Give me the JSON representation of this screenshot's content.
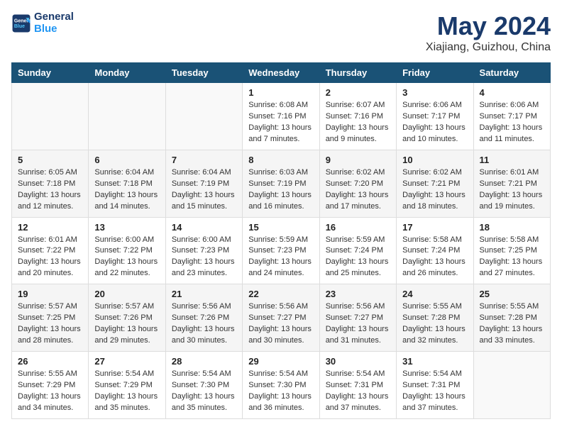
{
  "logo": {
    "line1": "General",
    "line2": "Blue"
  },
  "title": "May 2024",
  "location": "Xiajiang, Guizhou, China",
  "weekdays": [
    "Sunday",
    "Monday",
    "Tuesday",
    "Wednesday",
    "Thursday",
    "Friday",
    "Saturday"
  ],
  "weeks": [
    [
      {
        "day": "",
        "info": ""
      },
      {
        "day": "",
        "info": ""
      },
      {
        "day": "",
        "info": ""
      },
      {
        "day": "1",
        "info": "Sunrise: 6:08 AM\nSunset: 7:16 PM\nDaylight: 13 hours\nand 7 minutes."
      },
      {
        "day": "2",
        "info": "Sunrise: 6:07 AM\nSunset: 7:16 PM\nDaylight: 13 hours\nand 9 minutes."
      },
      {
        "day": "3",
        "info": "Sunrise: 6:06 AM\nSunset: 7:17 PM\nDaylight: 13 hours\nand 10 minutes."
      },
      {
        "day": "4",
        "info": "Sunrise: 6:06 AM\nSunset: 7:17 PM\nDaylight: 13 hours\nand 11 minutes."
      }
    ],
    [
      {
        "day": "5",
        "info": "Sunrise: 6:05 AM\nSunset: 7:18 PM\nDaylight: 13 hours\nand 12 minutes."
      },
      {
        "day": "6",
        "info": "Sunrise: 6:04 AM\nSunset: 7:18 PM\nDaylight: 13 hours\nand 14 minutes."
      },
      {
        "day": "7",
        "info": "Sunrise: 6:04 AM\nSunset: 7:19 PM\nDaylight: 13 hours\nand 15 minutes."
      },
      {
        "day": "8",
        "info": "Sunrise: 6:03 AM\nSunset: 7:19 PM\nDaylight: 13 hours\nand 16 minutes."
      },
      {
        "day": "9",
        "info": "Sunrise: 6:02 AM\nSunset: 7:20 PM\nDaylight: 13 hours\nand 17 minutes."
      },
      {
        "day": "10",
        "info": "Sunrise: 6:02 AM\nSunset: 7:21 PM\nDaylight: 13 hours\nand 18 minutes."
      },
      {
        "day": "11",
        "info": "Sunrise: 6:01 AM\nSunset: 7:21 PM\nDaylight: 13 hours\nand 19 minutes."
      }
    ],
    [
      {
        "day": "12",
        "info": "Sunrise: 6:01 AM\nSunset: 7:22 PM\nDaylight: 13 hours\nand 20 minutes."
      },
      {
        "day": "13",
        "info": "Sunrise: 6:00 AM\nSunset: 7:22 PM\nDaylight: 13 hours\nand 22 minutes."
      },
      {
        "day": "14",
        "info": "Sunrise: 6:00 AM\nSunset: 7:23 PM\nDaylight: 13 hours\nand 23 minutes."
      },
      {
        "day": "15",
        "info": "Sunrise: 5:59 AM\nSunset: 7:23 PM\nDaylight: 13 hours\nand 24 minutes."
      },
      {
        "day": "16",
        "info": "Sunrise: 5:59 AM\nSunset: 7:24 PM\nDaylight: 13 hours\nand 25 minutes."
      },
      {
        "day": "17",
        "info": "Sunrise: 5:58 AM\nSunset: 7:24 PM\nDaylight: 13 hours\nand 26 minutes."
      },
      {
        "day": "18",
        "info": "Sunrise: 5:58 AM\nSunset: 7:25 PM\nDaylight: 13 hours\nand 27 minutes."
      }
    ],
    [
      {
        "day": "19",
        "info": "Sunrise: 5:57 AM\nSunset: 7:25 PM\nDaylight: 13 hours\nand 28 minutes."
      },
      {
        "day": "20",
        "info": "Sunrise: 5:57 AM\nSunset: 7:26 PM\nDaylight: 13 hours\nand 29 minutes."
      },
      {
        "day": "21",
        "info": "Sunrise: 5:56 AM\nSunset: 7:26 PM\nDaylight: 13 hours\nand 30 minutes."
      },
      {
        "day": "22",
        "info": "Sunrise: 5:56 AM\nSunset: 7:27 PM\nDaylight: 13 hours\nand 30 minutes."
      },
      {
        "day": "23",
        "info": "Sunrise: 5:56 AM\nSunset: 7:27 PM\nDaylight: 13 hours\nand 31 minutes."
      },
      {
        "day": "24",
        "info": "Sunrise: 5:55 AM\nSunset: 7:28 PM\nDaylight: 13 hours\nand 32 minutes."
      },
      {
        "day": "25",
        "info": "Sunrise: 5:55 AM\nSunset: 7:28 PM\nDaylight: 13 hours\nand 33 minutes."
      }
    ],
    [
      {
        "day": "26",
        "info": "Sunrise: 5:55 AM\nSunset: 7:29 PM\nDaylight: 13 hours\nand 34 minutes."
      },
      {
        "day": "27",
        "info": "Sunrise: 5:54 AM\nSunset: 7:29 PM\nDaylight: 13 hours\nand 35 minutes."
      },
      {
        "day": "28",
        "info": "Sunrise: 5:54 AM\nSunset: 7:30 PM\nDaylight: 13 hours\nand 35 minutes."
      },
      {
        "day": "29",
        "info": "Sunrise: 5:54 AM\nSunset: 7:30 PM\nDaylight: 13 hours\nand 36 minutes."
      },
      {
        "day": "30",
        "info": "Sunrise: 5:54 AM\nSunset: 7:31 PM\nDaylight: 13 hours\nand 37 minutes."
      },
      {
        "day": "31",
        "info": "Sunrise: 5:54 AM\nSunset: 7:31 PM\nDaylight: 13 hours\nand 37 minutes."
      },
      {
        "day": "",
        "info": ""
      }
    ]
  ]
}
